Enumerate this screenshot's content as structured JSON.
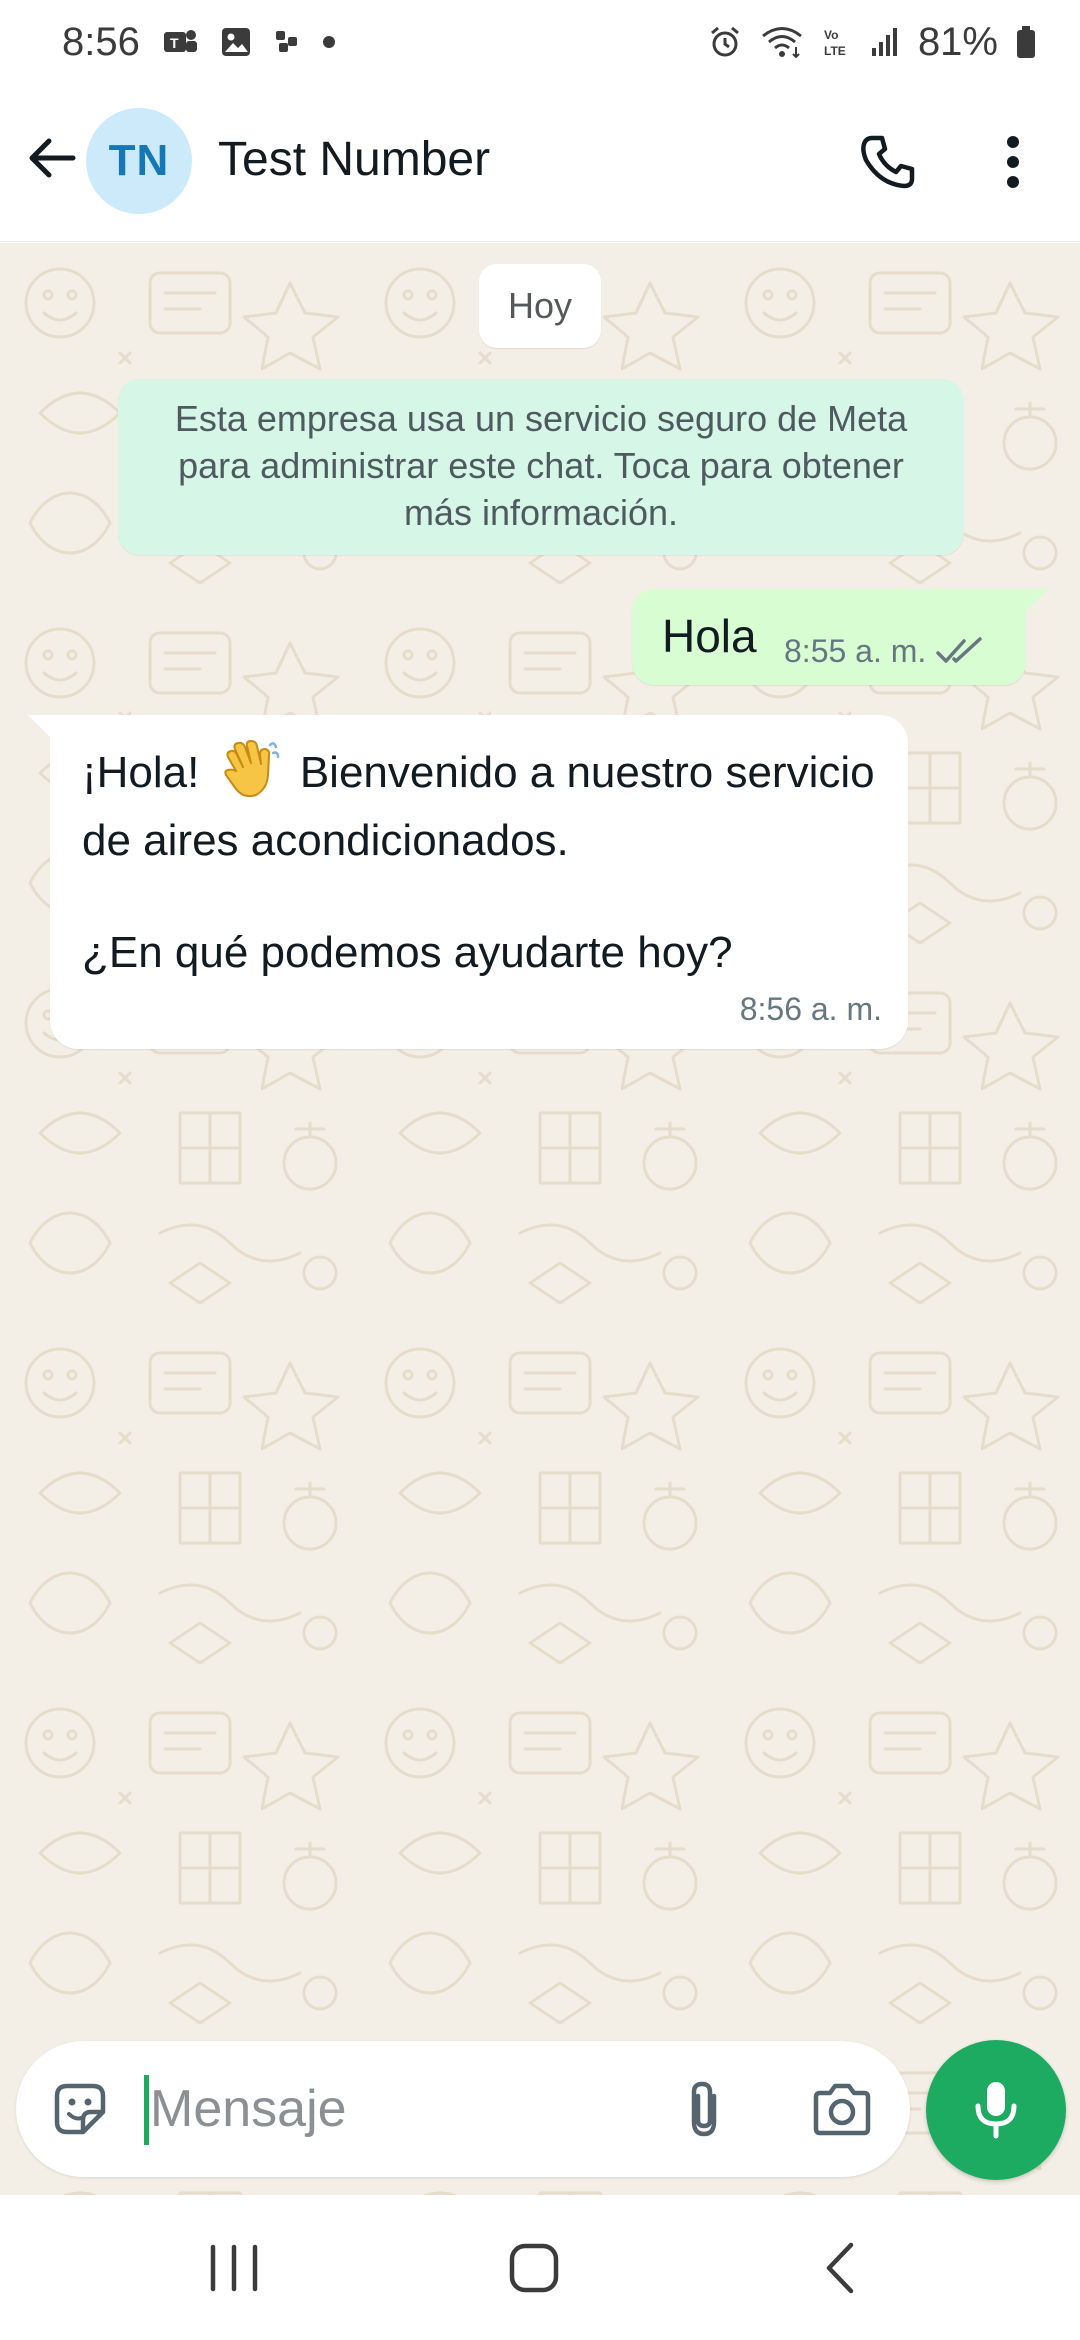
{
  "status_bar": {
    "time": "8:56",
    "battery": "81%",
    "left_icons": [
      "teams-notification-icon",
      "image-notification-icon",
      "slack-notification-icon",
      "more-notifications-dot-icon"
    ],
    "right_icons": [
      "alarm-icon",
      "wifi-icon",
      "volte-icon",
      "signal-icon",
      "battery-icon"
    ]
  },
  "header": {
    "avatar_initials": "TN",
    "contact_name": "Test Number",
    "icons": [
      "back-arrow-icon",
      "phone-icon",
      "more-vert-icon"
    ]
  },
  "chat": {
    "date_label": "Hoy",
    "system_notice": "Esta empresa usa un servicio seguro de Meta para administrar este chat. Toca para obtener más información.",
    "messages": [
      {
        "direction": "outgoing",
        "text": "Hola",
        "time": "8:55 a. m.",
        "status": "read-check-icon"
      },
      {
        "direction": "incoming",
        "paragraphs": [
          {
            "before": "¡Hola!",
            "emoji": "waving-hand-emoji",
            "after": "Bienvenido a nuestro servicio de aires acondicionados."
          },
          {
            "text": "¿En qué podemos ayudarte hoy?"
          }
        ],
        "time": "8:56 a. m."
      }
    ]
  },
  "composer": {
    "placeholder": "Mensaje",
    "value": "",
    "icons": [
      "sticker-icon",
      "attach-icon",
      "camera-icon",
      "mic-icon"
    ]
  },
  "nav_bar": {
    "icons": [
      "recent-apps-icon",
      "home-icon",
      "back-icon"
    ]
  },
  "colors": {
    "accent_green": "#1daa61",
    "outgoing_bubble": "#d9fdd3",
    "system_notice_bg": "#d6f6e7",
    "chat_wallpaper": "#f4efe6",
    "avatar_bg": "#cdeafb",
    "avatar_text": "#1677b6"
  }
}
